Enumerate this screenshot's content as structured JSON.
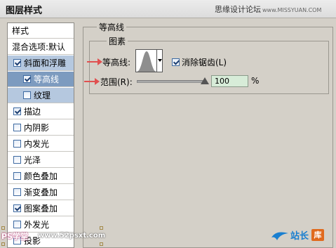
{
  "window": {
    "title": "图层样式",
    "watermark_top": "思缘设计论坛",
    "watermark_top_url": "www.MISSYUAN.COM"
  },
  "left_panel": {
    "header": "样式",
    "blend_options": "混合选项:默认",
    "items": [
      {
        "label": "斜面和浮雕",
        "checked": true,
        "selected": true
      },
      {
        "label": "等高线",
        "checked": true,
        "sub": true,
        "active": true
      },
      {
        "label": "纹理",
        "checked": false,
        "sub": true
      },
      {
        "label": "描边",
        "checked": true
      },
      {
        "label": "内阴影",
        "checked": false
      },
      {
        "label": "内发光",
        "checked": false
      },
      {
        "label": "光泽",
        "checked": false
      },
      {
        "label": "颜色叠加",
        "checked": false
      },
      {
        "label": "渐变叠加",
        "checked": false
      },
      {
        "label": "图案叠加",
        "checked": true
      },
      {
        "label": "外发光",
        "checked": false
      },
      {
        "label": "投影",
        "checked": false
      }
    ]
  },
  "contour_panel": {
    "group_title": "等高线",
    "subgroup_title": "图素",
    "contour_label": "等高线:",
    "anti_alias_label": "消除锯齿(L)",
    "anti_alias_checked": true,
    "range_label": "范围(R):",
    "range_value": "100",
    "range_unit": "%",
    "range_fraction": 1.0
  },
  "watermarks": {
    "bottom_left_ps": "PS学堂",
    "bottom_left_site": "www.52psxt.com",
    "bottom_right_text": "站长",
    "bottom_right_badge": "库"
  },
  "colors": {
    "dialog_bg": "#d4d0c8",
    "selected_row": "#b5c8df",
    "active_row": "#7d9bbf",
    "arrow": "#e05050",
    "range_input_bg": "#d7ecd8"
  }
}
